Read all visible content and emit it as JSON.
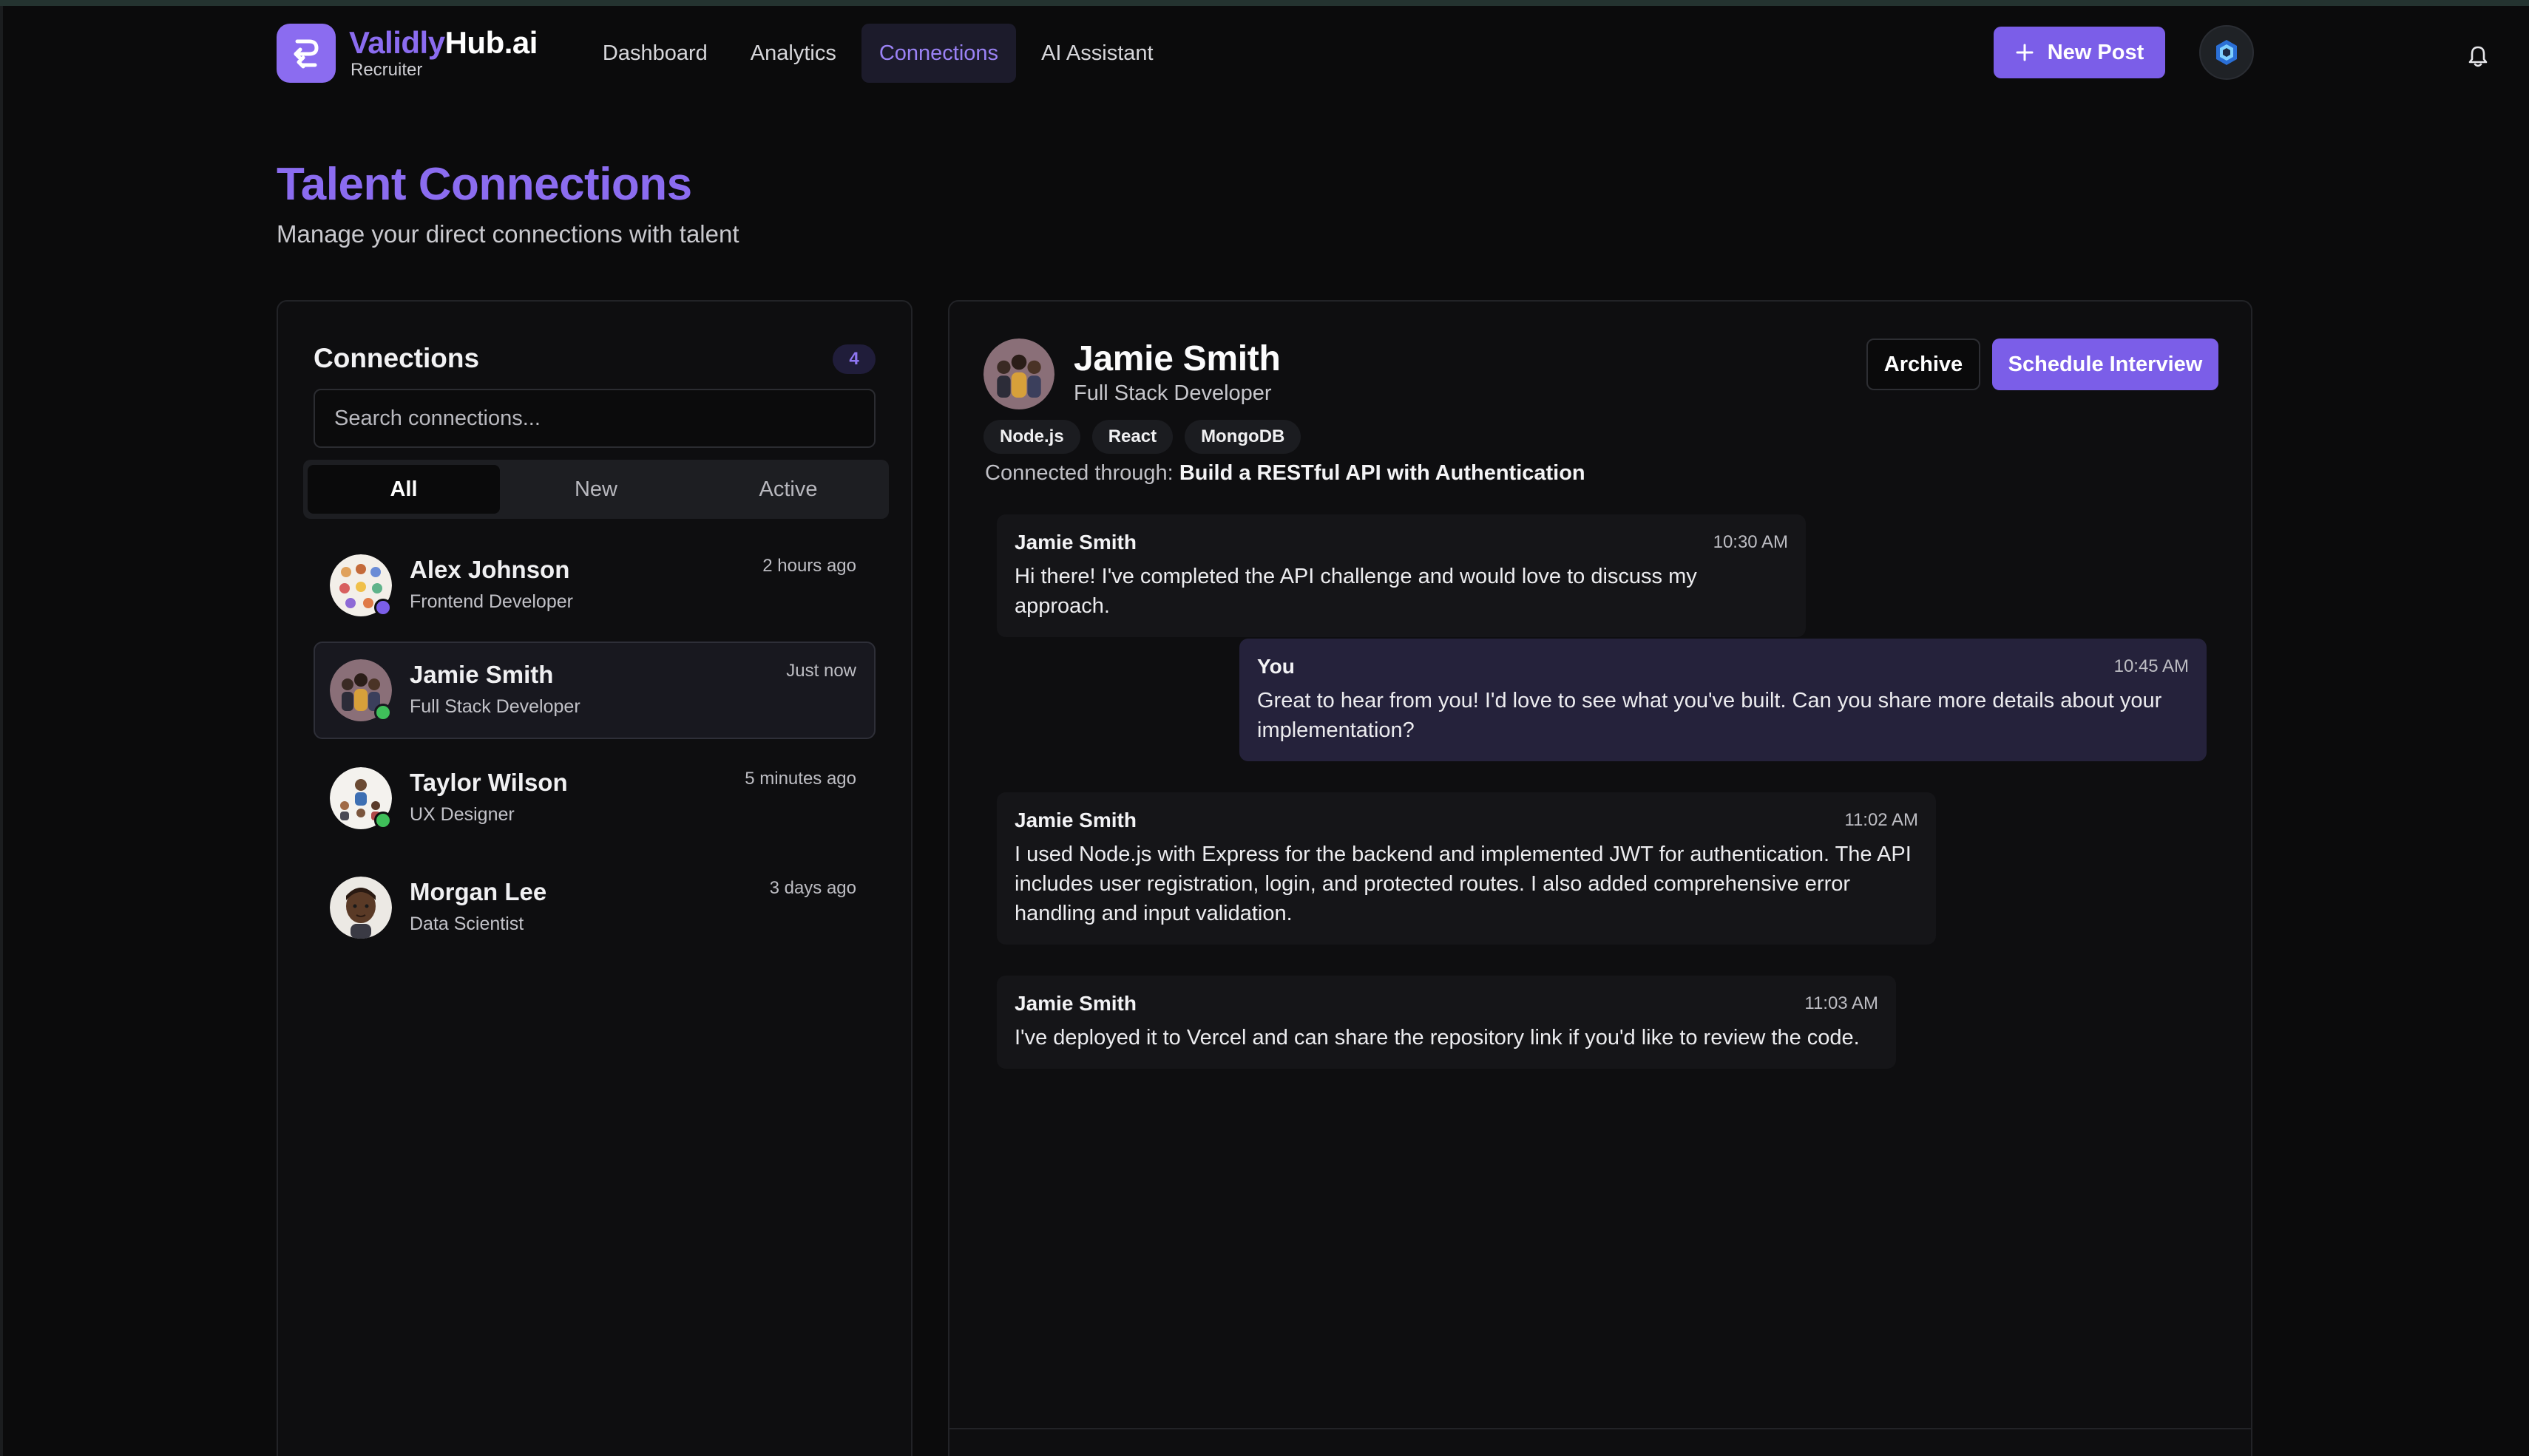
{
  "app": {
    "brand_prefix": "Validly",
    "brand_suffix": "Hub.ai",
    "role": "Recruiter",
    "accent": "#7b5ee8"
  },
  "nav": {
    "items": [
      {
        "label": "Dashboard",
        "active": false
      },
      {
        "label": "Analytics",
        "active": false
      },
      {
        "label": "Connections",
        "active": true
      },
      {
        "label": "AI Assistant",
        "active": false
      }
    ],
    "new_post_label": "New Post",
    "new_post_icon": "plus-icon",
    "notifications_icon": "bell-icon"
  },
  "page": {
    "title": "Talent Connections",
    "subtitle": "Manage your direct connections with talent"
  },
  "connections": {
    "title": "Connections",
    "count": "4",
    "search_placeholder": "Search connections...",
    "filters": [
      {
        "label": "All",
        "active": true
      },
      {
        "label": "New",
        "active": false
      },
      {
        "label": "Active",
        "active": false
      }
    ],
    "items": [
      {
        "name": "Alex Johnson",
        "role": "Frontend Developer",
        "time": "2 hours ago",
        "status_color": "#7b5ee8",
        "selected": false
      },
      {
        "name": "Jamie Smith",
        "role": "Full Stack Developer",
        "time": "Just now",
        "status_color": "#3fbf5a",
        "selected": true
      },
      {
        "name": "Taylor Wilson",
        "role": "UX Designer",
        "time": "5 minutes ago",
        "status_color": "#3fbf5a",
        "selected": false
      },
      {
        "name": "Morgan Lee",
        "role": "Data Scientist",
        "time": "3 days ago",
        "status_color": null,
        "selected": false
      }
    ]
  },
  "detail": {
    "name": "Jamie Smith",
    "role": "Full Stack Developer",
    "archive_label": "Archive",
    "schedule_label": "Schedule Interview",
    "skills": [
      "Node.js",
      "React",
      "MongoDB"
    ],
    "connected_through_label": "Connected through:",
    "connected_through_value": "Build a RESTful API with Authentication",
    "messages": [
      {
        "sender": "Jamie Smith",
        "time": "10:30 AM",
        "text": "Hi there! I've completed the API challenge and would love to discuss my approach.",
        "from_me": false
      },
      {
        "sender": "You",
        "time": "10:45 AM",
        "text": "Great to hear from you! I'd love to see what you've built. Can you share more details about your implementation?",
        "from_me": true
      },
      {
        "sender": "Jamie Smith",
        "time": "11:02 AM",
        "text": "I used Node.js with Express for the backend and implemented JWT for authentication. The API includes user registration, login, and protected routes. I also added comprehensive error handling and input validation.",
        "from_me": false
      },
      {
        "sender": "Jamie Smith",
        "time": "11:03 AM",
        "text": "I've deployed it to Vercel and can share the repository link if you'd like to review the code.",
        "from_me": false
      }
    ]
  }
}
